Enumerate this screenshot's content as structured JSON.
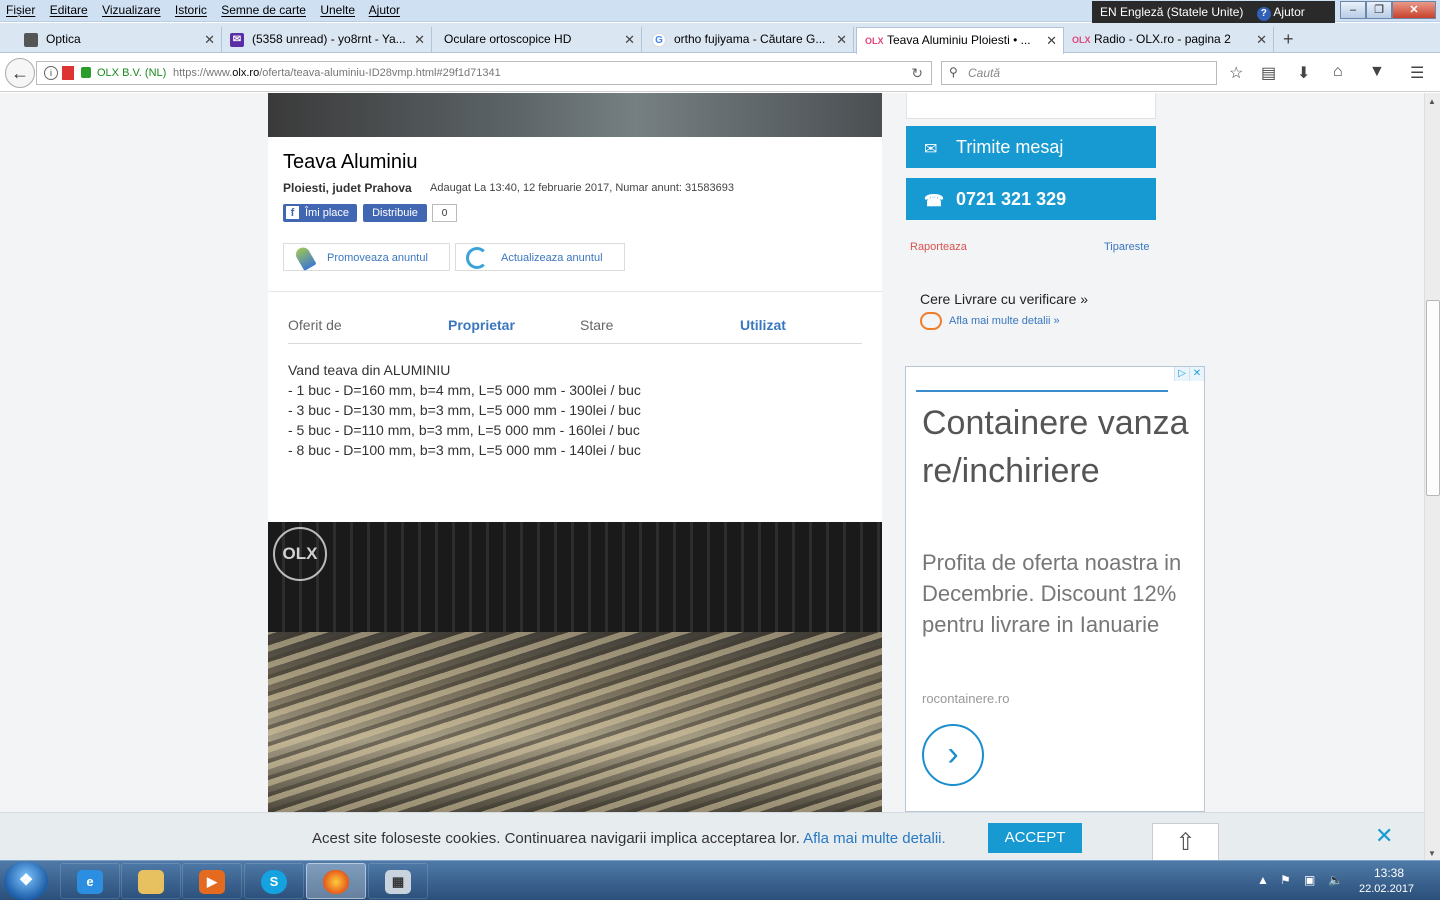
{
  "menubar": {
    "items": [
      "Fișier",
      "Editare",
      "Vizualizare",
      "Istoric",
      "Semne de carte",
      "Unelte",
      "Ajutor"
    ],
    "language": "EN Engleză (Statele Unite)",
    "help": "Ajutor"
  },
  "tabs": [
    {
      "label": "Optica",
      "icon": "image-tab-icon"
    },
    {
      "label": "(5358 unread) - yo8rnt - Ya...",
      "icon": "yahoo-mail-icon"
    },
    {
      "label": "Oculare ortoscopice HD",
      "icon": "blank-page-icon"
    },
    {
      "label": "ortho fujiyama - Căutare G...",
      "icon": "google-icon"
    },
    {
      "label": "Teava Aluminiu Ploiesti • ...",
      "icon": "olx-icon"
    },
    {
      "label": "Radio - OLX.ro - pagina 2",
      "icon": "olx-icon"
    }
  ],
  "navbar": {
    "org": "OLX B.V. (NL)",
    "url_prefix": "https://www.",
    "url_domain": "olx.ro",
    "url_path": "/oferta/teava-aluminiu-ID28vmp.html#29f1d71341",
    "search_placeholder": "Caută"
  },
  "ad": {
    "title": "Teava Aluminiu",
    "location": "Ploiesti, judet Prahova",
    "meta": "Adaugat La 13:40, 12 februarie 2017, Numar anunt: 31583693",
    "fb_like": "Îmi place",
    "fb_share": "Distribuie",
    "fb_count": "0",
    "promote": "Promoveaza anuntul",
    "update": "Actualizeaza anuntul",
    "details": {
      "offered_by_label": "Oferit de",
      "offered_by_value": "Proprietar",
      "condition_label": "Stare",
      "condition_value": "Utilizat"
    },
    "description": [
      "Vand teava din ALUMINIU",
      "- 1 buc - D=160 mm, b=4 mm, L=5 000 mm - 300lei / buc",
      "- 3 buc - D=130 mm, b=3 mm, L=5 000 mm - 190lei / buc",
      "- 5 buc - D=110 mm, b=3 mm, L=5 000 mm - 160lei / buc",
      "- 8 buc - D=100 mm, b=3 mm, L=5 000 mm - 140lei / buc"
    ],
    "watermark": "OLX"
  },
  "sidebar": {
    "message_btn": "Trimite mesaj",
    "phone_btn": "0721 321 329",
    "report": "Raporteaza",
    "print": "Tipareste",
    "delivery_title": "Cere Livrare cu verificare »",
    "delivery_link": "Afla mai multe detalii »"
  },
  "banner": {
    "headline": "Containere vanzare/inchiriere",
    "body": "Profita de oferta noastra in Decembrie. Discount 12% pentru livrare in Ianuarie",
    "domain": "rocontainere.ro"
  },
  "cookie": {
    "text": "Acest site foloseste cookies. Continuarea navigarii implica acceptarea lor.",
    "link": "Afla mai multe detalii.",
    "accept": "ACCEPT"
  },
  "taskbar": {
    "time": "13:38",
    "date": "22.02.2017"
  },
  "colors": {
    "accent": "#1799d1",
    "link": "#3a77bf",
    "report": "#d9534f"
  }
}
